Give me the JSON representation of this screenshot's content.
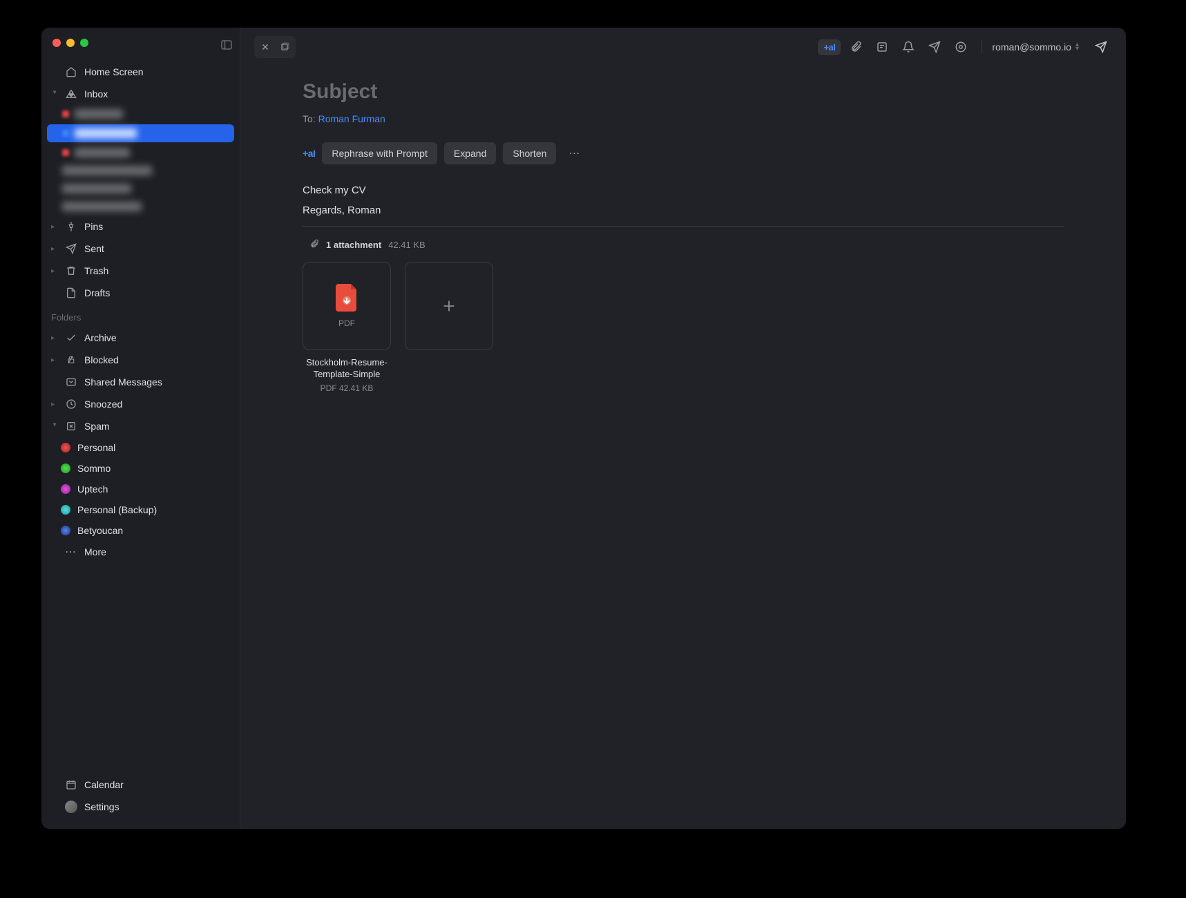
{
  "sidebar": {
    "home": "Home Screen",
    "inbox": "Inbox",
    "pins": "Pins",
    "sent": "Sent",
    "trash": "Trash",
    "drafts": "Drafts",
    "folders_label": "Folders",
    "archive": "Archive",
    "blocked": "Blocked",
    "shared": "Shared Messages",
    "snoozed": "Snoozed",
    "spam": "Spam",
    "accounts": {
      "personal": "Personal",
      "sommo": "Sommo",
      "uptech": "Uptech",
      "personal_backup": "Personal (Backup)",
      "betyoucan": "Betyoucan"
    },
    "more": "More",
    "calendar": "Calendar",
    "settings": "Settings"
  },
  "toolbar": {
    "ai_badge": "+aI",
    "account": "roman@sommo.io"
  },
  "compose": {
    "subject_placeholder": "Subject",
    "to_label": "To:",
    "recipient": "Roman Furman",
    "ai_label": "+aI",
    "ai_actions": {
      "rephrase": "Rephrase with Prompt",
      "expand": "Expand",
      "shorten": "Shorten"
    },
    "body": "Check my CV",
    "signature": "Regards, Roman",
    "attachment_count": "1 attachment",
    "attachment_total_size": "42.41 KB",
    "attachment": {
      "name": "Stockholm-Resume-Template-Simple",
      "type": "PDF",
      "size": "42.41 KB",
      "thumb_label": "PDF"
    }
  },
  "colors": {
    "accent": "#4a8bff",
    "bg": "#212227",
    "sidebar_bg": "#1e1f24"
  }
}
